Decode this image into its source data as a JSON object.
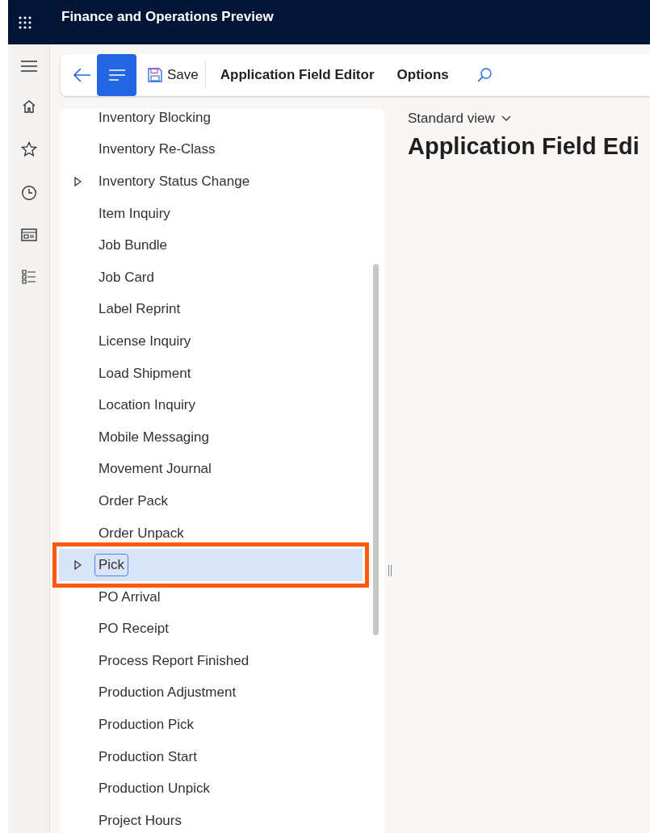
{
  "header": {
    "title": "Finance and Operations Preview"
  },
  "toolbar": {
    "save": "Save",
    "items": [
      {
        "label": "Application Field Editor"
      },
      {
        "label": "Options"
      }
    ]
  },
  "tree": {
    "items": [
      {
        "label": "Inventory Blocking",
        "expandable": false,
        "selected": false,
        "highlighted": false
      },
      {
        "label": "Inventory Re-Class",
        "expandable": false,
        "selected": false,
        "highlighted": false
      },
      {
        "label": "Inventory Status Change",
        "expandable": true,
        "selected": false,
        "highlighted": false
      },
      {
        "label": "Item Inquiry",
        "expandable": false,
        "selected": false,
        "highlighted": false
      },
      {
        "label": "Job Bundle",
        "expandable": false,
        "selected": false,
        "highlighted": false
      },
      {
        "label": "Job Card",
        "expandable": false,
        "selected": false,
        "highlighted": false
      },
      {
        "label": "Label Reprint",
        "expandable": false,
        "selected": false,
        "highlighted": false
      },
      {
        "label": "License Inquiry",
        "expandable": false,
        "selected": false,
        "highlighted": false
      },
      {
        "label": "Load Shipment",
        "expandable": false,
        "selected": false,
        "highlighted": false
      },
      {
        "label": "Location Inquiry",
        "expandable": false,
        "selected": false,
        "highlighted": false
      },
      {
        "label": "Mobile Messaging",
        "expandable": false,
        "selected": false,
        "highlighted": false
      },
      {
        "label": "Movement Journal",
        "expandable": false,
        "selected": false,
        "highlighted": false
      },
      {
        "label": "Order Pack",
        "expandable": false,
        "selected": false,
        "highlighted": false
      },
      {
        "label": "Order Unpack",
        "expandable": false,
        "selected": false,
        "highlighted": false
      },
      {
        "label": "Pick",
        "expandable": true,
        "selected": true,
        "highlighted": true
      },
      {
        "label": "PO Arrival",
        "expandable": false,
        "selected": false,
        "highlighted": false
      },
      {
        "label": "PO Receipt",
        "expandable": false,
        "selected": false,
        "highlighted": false
      },
      {
        "label": "Process Report Finished",
        "expandable": false,
        "selected": false,
        "highlighted": false
      },
      {
        "label": "Production Adjustment",
        "expandable": false,
        "selected": false,
        "highlighted": false
      },
      {
        "label": "Production Pick",
        "expandable": false,
        "selected": false,
        "highlighted": false
      },
      {
        "label": "Production Start",
        "expandable": false,
        "selected": false,
        "highlighted": false
      },
      {
        "label": "Production Unpick",
        "expandable": false,
        "selected": false,
        "highlighted": false
      },
      {
        "label": "Project Hours",
        "expandable": false,
        "selected": false,
        "highlighted": false
      }
    ]
  },
  "content": {
    "view": "Standard view",
    "title": "Application Field Edi"
  }
}
